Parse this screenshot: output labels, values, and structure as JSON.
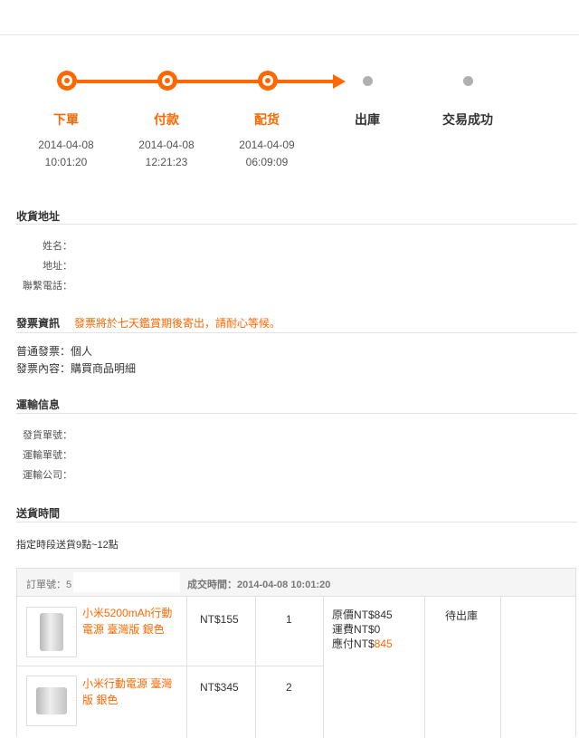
{
  "progress": {
    "steps": [
      {
        "label": "下單",
        "date": "2014-04-08",
        "time": "10:01:20"
      },
      {
        "label": "付款",
        "date": "2014-04-08",
        "time": "12:21:23"
      },
      {
        "label": "配货",
        "date": "2014-04-09",
        "time": "06:09:09"
      },
      {
        "label": "出庫",
        "date": "",
        "time": ""
      },
      {
        "label": "交易成功",
        "date": "",
        "time": ""
      }
    ]
  },
  "address": {
    "title": "收貨地址",
    "name_label": "姓名：",
    "addr_label": "地址：",
    "phone_label": "聯繫電話："
  },
  "invoice": {
    "title": "發票資訊",
    "notice": "發票將於七天鑑賞期後寄出，請耐心等候。",
    "type_line": "普通發票：個人",
    "content_line": "發票內容：購買商品明細"
  },
  "shipping": {
    "title": "運輸信息",
    "ship_no_label": "發貨單號：",
    "track_no_label": "運輸單號：",
    "carrier_label": "運輸公司："
  },
  "delivery": {
    "title": "送貨時間",
    "text": "指定時段送貨9點~12點"
  },
  "order": {
    "order_no_label": "訂單號：5",
    "deal_time": "成交時間：2014-04-08 10:01:20",
    "items": [
      {
        "name": "小米5200mAh行動電源 臺灣版 銀色",
        "price": "NT$155",
        "qty": "1"
      },
      {
        "name": "小米行動電源 臺灣版 銀色",
        "price": "NT$345",
        "qty": "2"
      }
    ],
    "original_price": "原價NT$845",
    "shipping_fee": "運費NT$0",
    "payable_label": "應付NT$",
    "payable_value": "845",
    "status": "待出庫"
  },
  "colors": {
    "accent": "#ff6700",
    "inactive": "#b0b0b0"
  }
}
